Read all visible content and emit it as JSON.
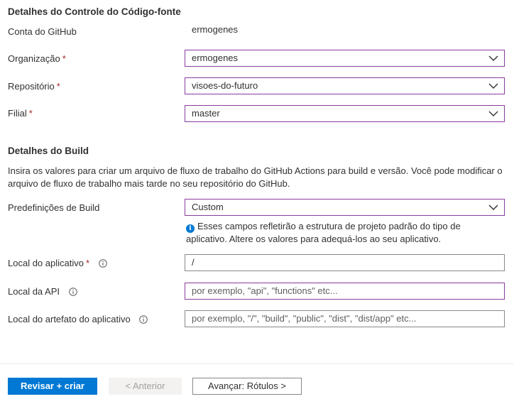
{
  "source_control": {
    "title": "Detalhes do Controle do Código-fonte",
    "github_account_label": "Conta do GitHub",
    "github_account_value": "ermogenes",
    "organization_label": "Organização",
    "organization_value": "ermogenes",
    "repository_label": "Repositório",
    "repository_value": "visoes-do-futuro",
    "branch_label": "Filial",
    "branch_value": "master",
    "required_marker": "*"
  },
  "build": {
    "title": "Detalhes do Build",
    "description": "Insira os valores para criar um arquivo de fluxo de trabalho do GitHub Actions para build e versão. Você pode modificar o arquivo de fluxo de trabalho mais tarde no seu repositório do GitHub.",
    "presets_label": "Predefinições de Build",
    "presets_value": "Custom",
    "presets_hint": "Esses campos refletirão a estrutura de projeto padrão do tipo de aplicativo. Altere os valores para adequá-los ao seu aplicativo.",
    "app_location_label": "Local do aplicativo",
    "app_location_value": "/",
    "api_location_label": "Local da API",
    "api_location_placeholder": "por exemplo, \"api\", \"functions\" etc...",
    "artifact_location_label": "Local do artefato do aplicativo",
    "artifact_location_placeholder": "por exemplo, \"/\", \"build\", \"public\", \"dist\", \"dist/app\" etc..."
  },
  "footer": {
    "review_create_label": "Revisar + criar",
    "previous_label": "< Anterior",
    "next_label": "Avançar: Rótulos >"
  },
  "colors": {
    "primary": "#0078d4",
    "focus_border": "#8a3c9e",
    "required": "#a4262c"
  }
}
